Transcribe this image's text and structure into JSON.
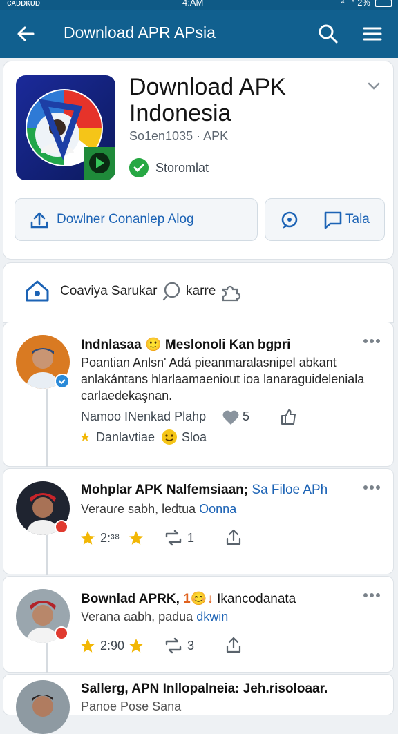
{
  "status_bar": {
    "carrier": "ᴄᴀᴅᴅᴋᴜᴅ",
    "time": "4:AM",
    "signal": "⁴ ᴵ ⁵ 2%"
  },
  "app_bar": {
    "title": "Download APR APsia",
    "back_icon": "arrow-left-icon",
    "search_icon": "search-icon",
    "menu_icon": "hamburger-menu-icon",
    "color": "#11608f"
  },
  "app": {
    "name_line1": "Download APK",
    "name_line2": "Indonesia",
    "meta": "So1en1035 · APK",
    "verified": "Storomlat",
    "download_button": "Dowlner Conanlep Alog",
    "talk_button": "Tala"
  },
  "tabs": {
    "home": "Coaviya Sarukar",
    "search": "karre"
  },
  "posts": [
    {
      "name": "Indnlasaa",
      "tag": "Meslonoli Kan bgpri",
      "emoji": "🙂",
      "body": "Poantian Anlsn' Adá pieanmaralasnipel abkant anlakántans hlarlaamaeniout ioa lanaraguideleniala carlaedekaşnan.",
      "line1": "Namoo INenkad Plahp",
      "likes": "5",
      "line2_icon": "★",
      "line2": "Danlavtiae",
      "line2b": "Sloa"
    },
    {
      "name": "Mohplar APK Nalfemsiaan;",
      "tag": "Sa Filoe APh",
      "sub": "Verauɾe sabh, ",
      "sub_tag_plain": "ledtua",
      "sub_tag": "Oonna",
      "time": "2:ᶟ⁸",
      "reposts": "1"
    },
    {
      "name": "Bownlad APRK, ",
      "emoji": "1😊↓",
      "tag_plain": "Ikancodanata",
      "sub": "Verana aabh, ",
      "sub_plain": "padua",
      "sub_tag": "dkwin",
      "time": "2:90",
      "reposts": "3"
    },
    {
      "name": "Sallerg, APN Inllopalneia: Jeh.risoloaar.",
      "sub": "Panoe Pose Sana"
    }
  ]
}
